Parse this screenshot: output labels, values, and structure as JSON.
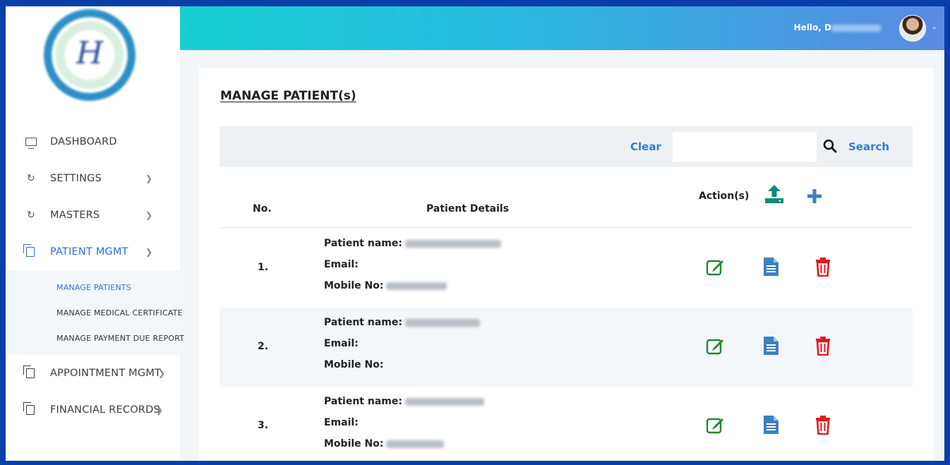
{
  "header": {
    "greeting": "Hello, D"
  },
  "sidebar": {
    "items": [
      {
        "label": "DASHBOARD",
        "icon": "monitor-icon"
      },
      {
        "label": "SETTINGS",
        "icon": "refresh-icon"
      },
      {
        "label": "MASTERS",
        "icon": "refresh-icon"
      },
      {
        "label": "PATIENT MGMT",
        "icon": "copy-icon"
      },
      {
        "label": "APPOINTMENT MGMT",
        "icon": "copy-icon"
      },
      {
        "label": "FINANCIAL RECORDS",
        "icon": "copy-icon"
      }
    ],
    "patient_sub": [
      {
        "label": "MANAGE PATIENTS"
      },
      {
        "label": "MANAGE MEDICAL CERTIFICATE"
      },
      {
        "label": "MANAGE PAYMENT DUE REPORT"
      }
    ]
  },
  "page": {
    "title": "MANAGE PATIENT(s)"
  },
  "search": {
    "clear_label": "Clear",
    "search_label": "Search",
    "value": ""
  },
  "table": {
    "headers": {
      "no": "No.",
      "details": "Patient Details",
      "actions": "Action(s)"
    },
    "field_labels": {
      "name": "Patient name:",
      "email": "Email:",
      "mobile": "Mobile No:"
    },
    "rows": [
      {
        "no": "1."
      },
      {
        "no": "2."
      },
      {
        "no": "3."
      }
    ]
  },
  "colors": {
    "accent": "#2f7fd8",
    "edit": "#1f8a2e",
    "delete": "#e01b1b",
    "doc": "#3f7fc4",
    "upload": "#0f8a7a"
  }
}
